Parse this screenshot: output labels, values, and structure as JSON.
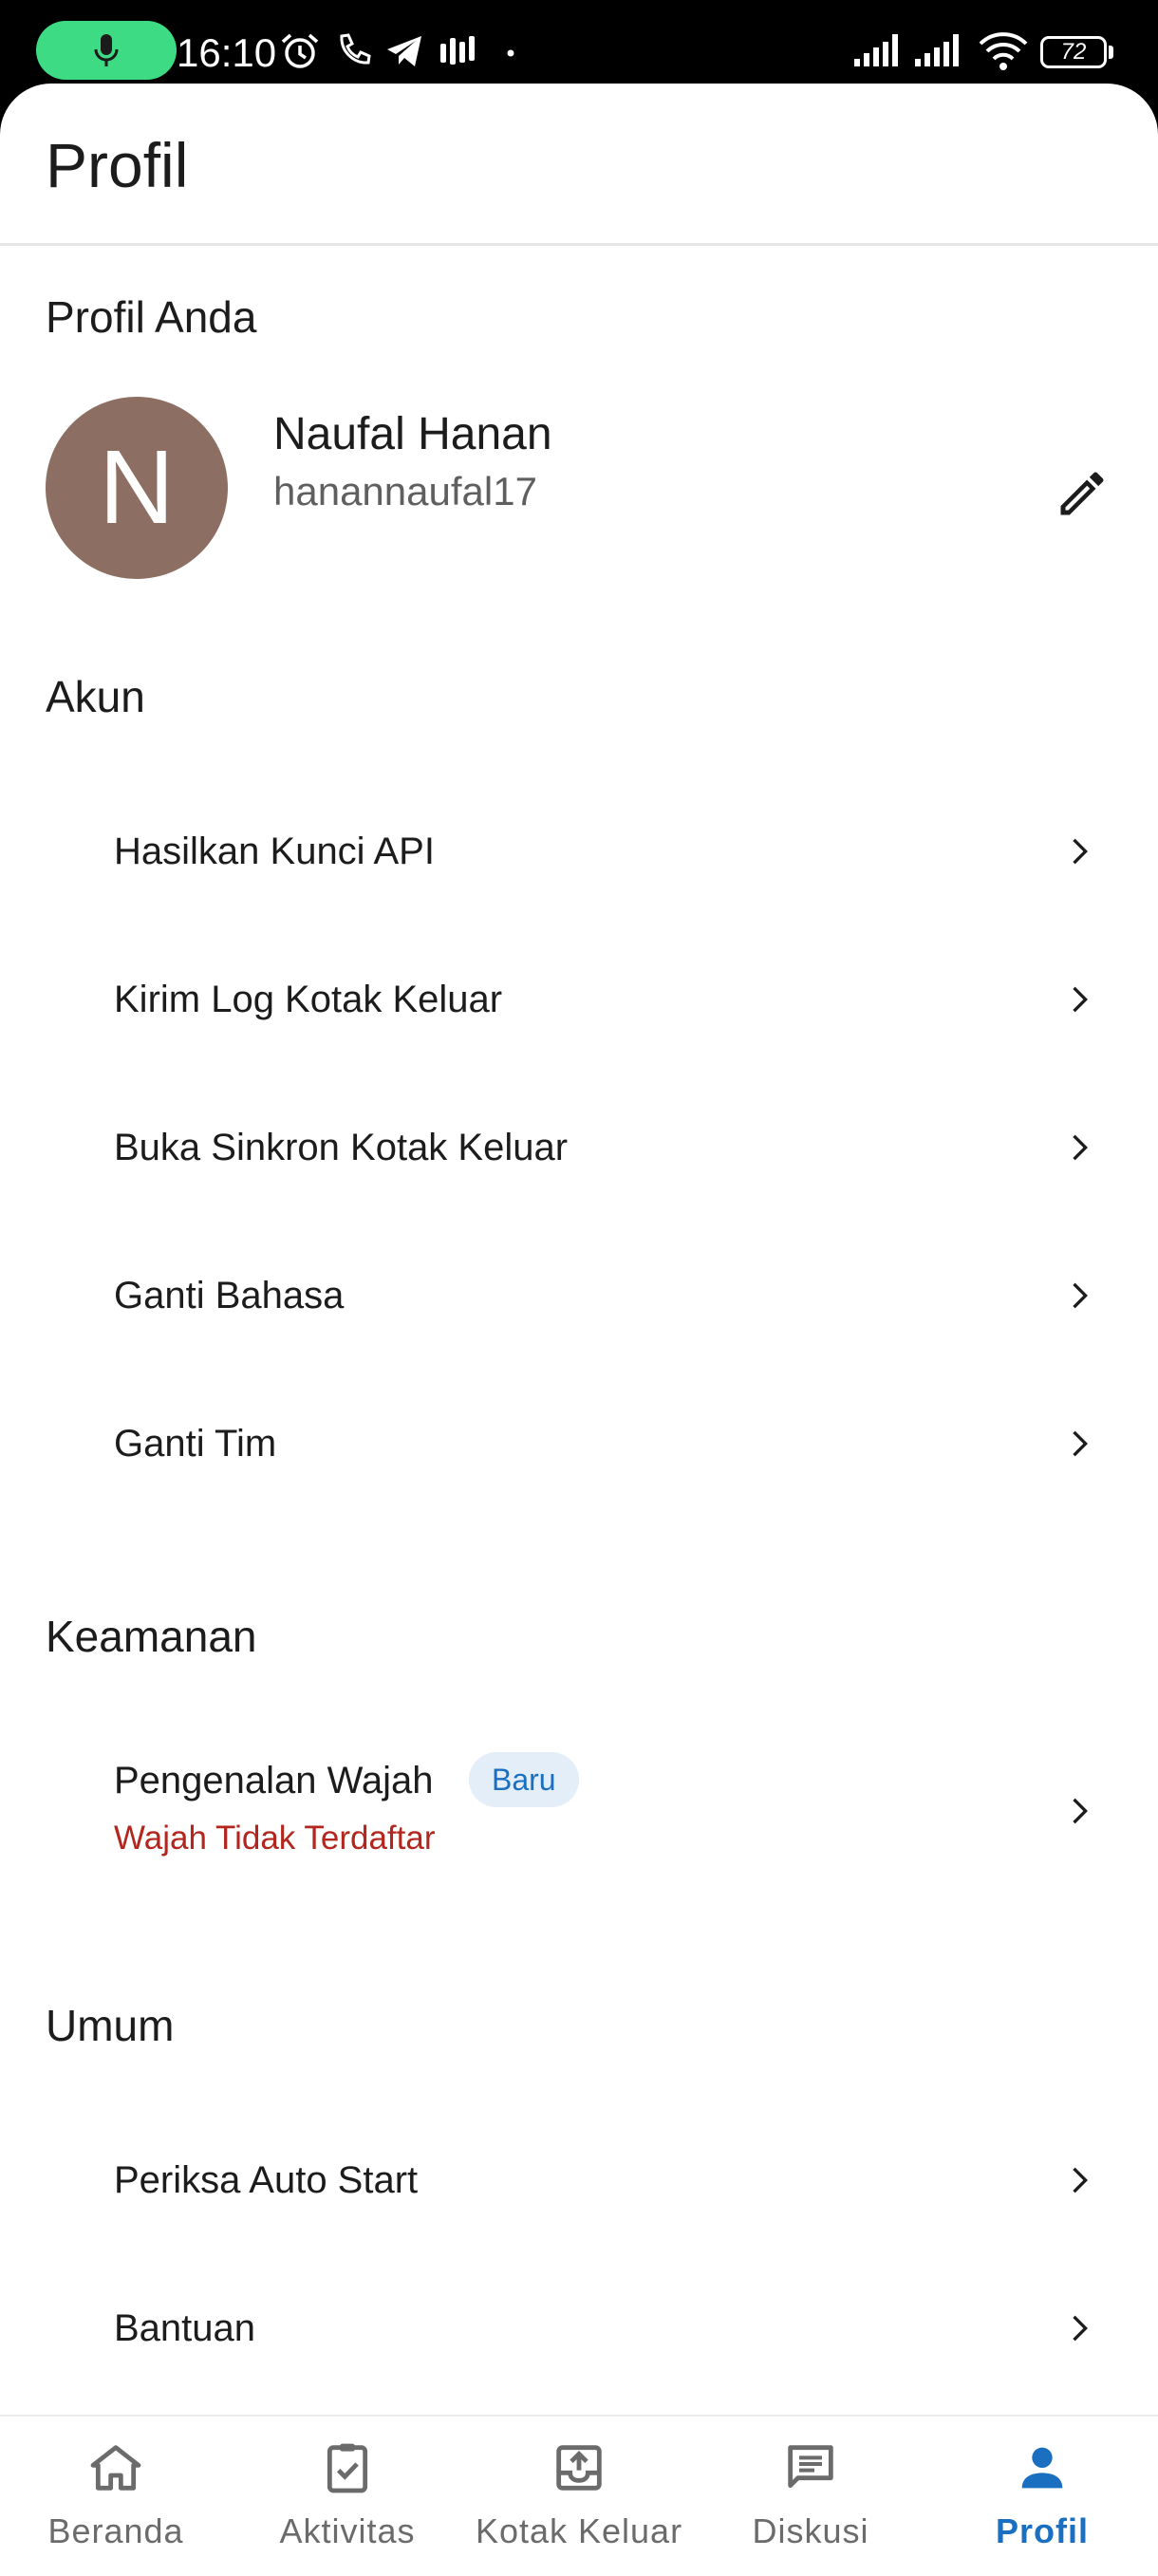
{
  "status_bar": {
    "time": "16:10",
    "battery": "72"
  },
  "app_bar": {
    "title": "Profil"
  },
  "profile": {
    "section_title": "Profil Anda",
    "avatar_initial": "N",
    "avatar_color": "#8d6e63",
    "name": "Naufal Hanan",
    "username": "hanannaufal17"
  },
  "account": {
    "section_title": "Akun",
    "items": [
      {
        "label": "Hasilkan Kunci API"
      },
      {
        "label": "Kirim Log Kotak Keluar"
      },
      {
        "label": "Buka Sinkron Kotak Keluar"
      },
      {
        "label": "Ganti Bahasa"
      },
      {
        "label": "Ganti Tim"
      }
    ]
  },
  "security": {
    "section_title": "Keamanan",
    "face_recognition": {
      "label": "Pengenalan Wajah",
      "badge": "Baru",
      "status": "Wajah Tidak Terdaftar"
    }
  },
  "general": {
    "section_title": "Umum",
    "items": [
      {
        "label": "Periksa Auto Start"
      },
      {
        "label": "Bantuan"
      }
    ]
  },
  "bottom_nav": {
    "items": [
      {
        "label": "Beranda",
        "icon": "home-icon"
      },
      {
        "label": "Aktivitas",
        "icon": "task-check-icon"
      },
      {
        "label": "Kotak Keluar",
        "icon": "outbox-icon"
      },
      {
        "label": "Diskusi",
        "icon": "chat-icon"
      },
      {
        "label": "Profil",
        "icon": "person-icon",
        "active": true
      }
    ]
  },
  "colors": {
    "accent": "#1a6fc1",
    "error": "#b3261e",
    "mic_indicator": "#3ddc84"
  }
}
